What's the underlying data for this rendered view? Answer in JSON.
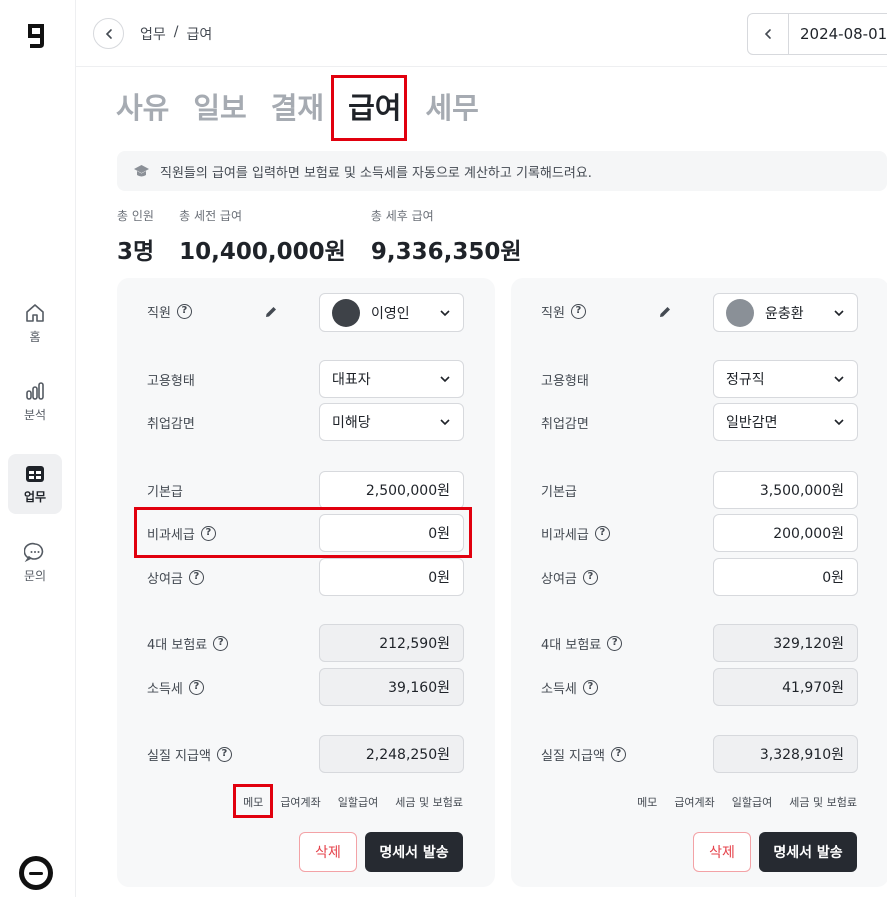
{
  "breadcrumb": {
    "section": "업무",
    "separator": "/",
    "page": "급여"
  },
  "date_picker": {
    "value": "2024-08-01"
  },
  "sidebar": {
    "items": [
      {
        "label": "홈",
        "icon": "home-icon"
      },
      {
        "label": "분석",
        "icon": "bar-chart-icon"
      },
      {
        "label": "업무",
        "icon": "table-icon"
      },
      {
        "label": "문의",
        "icon": "chat-icon"
      }
    ]
  },
  "tabs": [
    {
      "label": "사유"
    },
    {
      "label": "일보"
    },
    {
      "label": "결재"
    },
    {
      "label": "급여",
      "active": true
    },
    {
      "label": "세무"
    }
  ],
  "banner": {
    "text": "직원들의 급여를 입력하면 보험료 및 소득세를 자동으로 계산하고 기록해드려요."
  },
  "summary": {
    "total_staff_label": "총 인원",
    "total_staff": "3명",
    "pretax_label": "총 세전 급여",
    "pretax": "10,400,000원",
    "aftertax_label": "총 세후 급여",
    "aftertax": "9,336,350원"
  },
  "labels": {
    "employee": "직원",
    "employment_type": "고용형태",
    "exemption": "취업감면",
    "base_pay": "기본급",
    "nontax_pay": "비과세급",
    "bonus": "상여금",
    "insurance": "4대 보험료",
    "income_tax": "소득세",
    "net_pay": "실질 지급액",
    "memo": "메모",
    "account": "급여계좌",
    "daily_pay": "일할급여",
    "tax_insurance": "세금 및 보험료",
    "delete": "삭제",
    "send": "명세서 발송"
  },
  "cards": [
    {
      "employee": "이영인",
      "employment_type": "대표자",
      "exemption": "미해당",
      "base_pay": "2,500,000원",
      "nontax_pay": "0원",
      "bonus": "0원",
      "insurance": "212,590원",
      "income_tax": "39,160원",
      "net_pay": "2,248,250원"
    },
    {
      "employee": "윤충환",
      "employment_type": "정규직",
      "exemption": "일반감면",
      "base_pay": "3,500,000원",
      "nontax_pay": "200,000원",
      "bonus": "0원",
      "insurance": "329,120원",
      "income_tax": "41,970원",
      "net_pay": "3,328,910원"
    }
  ],
  "colors": {
    "highlight": "#e1000e",
    "primary_button": "#262a31",
    "delete_text": "#e5414a"
  }
}
